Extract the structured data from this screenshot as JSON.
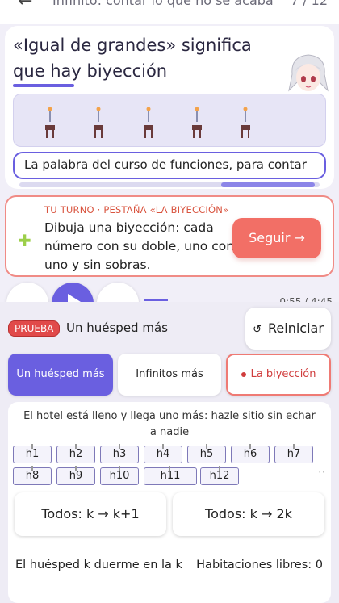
{
  "topbar": {
    "back_icon": "arrow-left-icon",
    "title": "Infinito: contar lo que no se acaba",
    "pager": "7 / 12"
  },
  "lesson": {
    "title": "«Igual de grandes» significa que hay biyección",
    "caption": "La palabra del curso de funciones, para contar"
  },
  "turn": {
    "tag": "TU TURNO · PESTAÑA «LA BIYECCIÓN»",
    "text": "Dibuja una biyección: cada número con su doble, uno con uno y sin sobras.",
    "button": "Seguir →",
    "icon": "puzzle-icon"
  },
  "player": {
    "time": "0:55 / 4:45"
  },
  "test": {
    "badge": "PRUEBA",
    "title": "Un huésped más",
    "reset": "Reiniciar",
    "reset_icon": "rotate-icon"
  },
  "tabs": [
    {
      "label": "Un huésped más"
    },
    {
      "label": "Infinitos más"
    },
    {
      "label": "La biyección"
    }
  ],
  "hotel": {
    "description": "El hotel está lleno y llega uno más: hazle sitio sin echar a nadie",
    "rooms": [
      "h1",
      "h2",
      "h3",
      "h4",
      "h5",
      "h6",
      "h7",
      "h8",
      "h9",
      "h10",
      "h11",
      "h12"
    ],
    "more": "··",
    "action_1": "Todos: k → k+1",
    "action_2": "Todos: k → 2k",
    "status_left": "El huésped k duerme en la k",
    "status_right": "Habitaciones libres: 0"
  },
  "colors": {
    "accent": "#6a5fe0",
    "warn": "#f26f66"
  }
}
